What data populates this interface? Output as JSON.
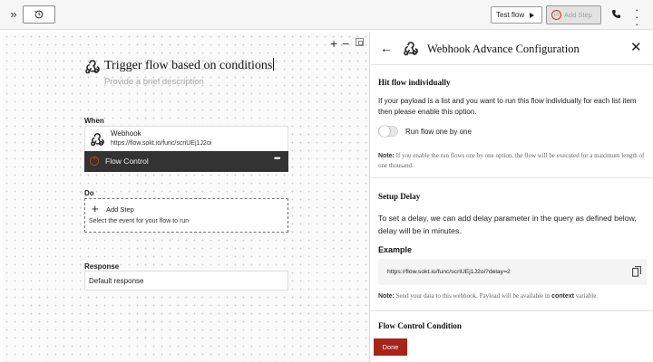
{
  "topbar": {
    "expand_glyph": "»",
    "history_icon": "history-icon",
    "test_flow_label": "Test flow",
    "add_step_badge": "1/2",
    "add_step_label": "Add Step",
    "phone_icon": "phone-icon",
    "more_icon": "vertical-dots-icon"
  },
  "canvas": {
    "zoom_in": "+",
    "zoom_out": "−",
    "flow_title": "Trigger flow based on conditions",
    "flow_desc_placeholder": "Provide a brief description",
    "when_label": "When",
    "webhook_title": "Webhook",
    "webhook_url": "https://flow.sokt.io/func/scriUEj1J2oi",
    "flow_control_label": "Flow Control",
    "more_glyph": "•••",
    "do_label": "Do",
    "add_step_label": "Add Step",
    "add_step_hint": "Select the event for your flow to run",
    "response_label": "Response",
    "response_value": "Default response"
  },
  "panel": {
    "back_glyph": "←",
    "title": "Webhook Advance Configuration",
    "close_glyph": "✕",
    "hit_flow": {
      "heading": "Hit flow individually",
      "description": "If your payload is a list and you want to run this flow individually for each list item then please enable this option.",
      "toggle_label": "Run flow one by one",
      "toggle_on": false,
      "note_label": "Note:",
      "note_text": " If you enable the run flows one by one option, the flow will be executed for a maximum length of one thousand."
    },
    "setup_delay": {
      "heading": "Setup Delay",
      "description": "To set a delay, we can add delay parameter in the query as defined below, delay will be in minutes.",
      "example_label": "Example",
      "example_url": "https://flow.sokt.io/func/scriUEj1J2oi?delay=2",
      "note_label": "Note:",
      "note_text_1": " Send your data to this webhook. Payload will be available in ",
      "note_keyword": "context",
      "note_text_2": " variable."
    },
    "flow_control": {
      "heading": "Flow Control Condition"
    },
    "done_label": "Done"
  },
  "colors": {
    "accent_red": "#a8231a",
    "flow_control_bar": "#333333"
  }
}
